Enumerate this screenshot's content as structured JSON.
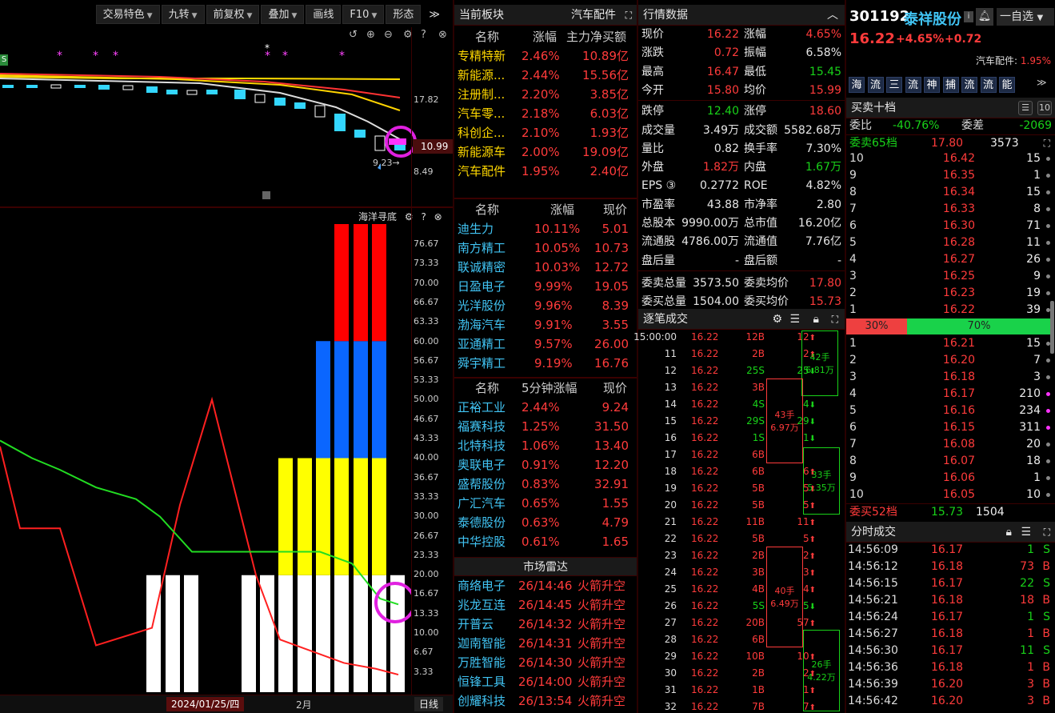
{
  "toolbar": {
    "buttons": [
      "交易特色",
      "九转",
      "前复权",
      "叠加",
      "画线",
      "F10",
      "形态"
    ],
    "more": "≫"
  },
  "kline": {
    "labels": [
      "17.82",
      "10.99",
      "8.49"
    ],
    "low_marker": "9.23",
    "sell_marker": "S"
  },
  "indicator": {
    "title": "海洋寻底",
    "axis": [
      "76.67",
      "73.33",
      "70.00",
      "66.67",
      "63.33",
      "60.00",
      "56.67",
      "53.33",
      "50.00",
      "46.67",
      "43.33",
      "40.00",
      "36.67",
      "33.33",
      "30.00",
      "26.67",
      "23.33",
      "20.00",
      "16.67",
      "13.33",
      "10.00",
      "6.67",
      "3.33"
    ],
    "red_line": [
      42,
      28,
      28,
      8,
      11,
      32,
      50,
      20,
      9,
      5,
      4,
      3,
      20,
      24
    ],
    "green_line": [
      22,
      20,
      18,
      15,
      13,
      10,
      8,
      8,
      7,
      7,
      7,
      6,
      4,
      3
    ],
    "bars": [
      1,
      1,
      1,
      0,
      1,
      1,
      1,
      2,
      2,
      2,
      4,
      4,
      4
    ],
    "date": "2024/01/25/四",
    "month": "2月",
    "period": "日线"
  },
  "sector": {
    "title": "当前板块",
    "current": "汽车配件",
    "headers": [
      "名称",
      "涨幅",
      "主力净买额"
    ],
    "rows": [
      [
        "专精特新",
        "2.46%",
        "10.89亿"
      ],
      [
        "新能源...",
        "2.44%",
        "15.56亿"
      ],
      [
        "注册制...",
        "2.20%",
        "3.85亿"
      ],
      [
        "汽车零...",
        "2.18%",
        "6.03亿"
      ],
      [
        "科创企...",
        "2.10%",
        "1.93亿"
      ],
      [
        "新能源车",
        "2.00%",
        "19.09亿"
      ],
      [
        "汽车配件",
        "1.95%",
        "2.40亿"
      ]
    ]
  },
  "gainers": {
    "headers": [
      "名称",
      "涨幅",
      "现价"
    ],
    "rows": [
      [
        "迪生力",
        "10.11%",
        "5.01"
      ],
      [
        "南方精工",
        "10.05%",
        "10.73"
      ],
      [
        "联诚精密",
        "10.03%",
        "12.72"
      ],
      [
        "日盈电子",
        "9.99%",
        "19.05"
      ],
      [
        "光洋股份",
        "9.96%",
        "8.39"
      ],
      [
        "渤海汽车",
        "9.91%",
        "3.55"
      ],
      [
        "亚通精工",
        "9.57%",
        "26.00"
      ],
      [
        "舜宇精工",
        "9.19%",
        "16.76"
      ]
    ]
  },
  "five_min": {
    "headers": [
      "名称",
      "5分钟涨幅",
      "现价"
    ],
    "rows": [
      [
        "正裕工业",
        "2.44%",
        "9.24"
      ],
      [
        "福赛科技",
        "1.25%",
        "31.50"
      ],
      [
        "北特科技",
        "1.06%",
        "13.40"
      ],
      [
        "奥联电子",
        "0.91%",
        "12.20"
      ],
      [
        "盛帮股份",
        "0.83%",
        "32.91"
      ],
      [
        "广汇汽车",
        "0.65%",
        "1.55"
      ],
      [
        "泰德股份",
        "0.63%",
        "4.79"
      ],
      [
        "中华控股",
        "0.61%",
        "1.65"
      ]
    ]
  },
  "radar": {
    "title": "市场雷达",
    "rows": [
      [
        "商络电子",
        "26/14:46",
        "火箭升空"
      ],
      [
        "兆龙互连",
        "26/14:45",
        "火箭升空"
      ],
      [
        "开普云",
        "26/14:32",
        "火箭升空"
      ],
      [
        "迦南智能",
        "26/14:31",
        "火箭升空"
      ],
      [
        "万胜智能",
        "26/14:30",
        "火箭升空"
      ],
      [
        "恒锋工具",
        "26/14:00",
        "火箭升空"
      ],
      [
        "创耀科技",
        "26/13:54",
        "火箭升空"
      ]
    ]
  },
  "quote": {
    "title": "行情数据",
    "rows": [
      [
        "现价",
        "16.22",
        "涨幅",
        "4.65%"
      ],
      [
        "涨跌",
        "0.72",
        "振幅",
        "6.58%"
      ],
      [
        "最高",
        "16.47",
        "最低",
        "15.45"
      ],
      [
        "今开",
        "15.80",
        "均价",
        "15.99"
      ],
      [
        "跌停",
        "12.40",
        "涨停",
        "18.60"
      ],
      [
        "成交量",
        "3.49万",
        "成交额",
        "5582.68万"
      ],
      [
        "量比",
        "0.82",
        "换手率",
        "7.30%"
      ],
      [
        "外盘",
        "1.82万",
        "内盘",
        "1.67万"
      ],
      [
        "EPS ③",
        "0.2772",
        "ROE",
        "4.82%"
      ],
      [
        "市盈率",
        "43.88",
        "市净率",
        "2.80"
      ],
      [
        "总股本",
        "9990.00万",
        "总市值",
        "16.20亿"
      ],
      [
        "流通股",
        "4786.00万",
        "流通值",
        "7.76亿"
      ],
      [
        "盘后量",
        "-",
        "盘后额",
        "-"
      ],
      [
        "委卖总量",
        "3573.50",
        "委卖均价",
        "17.80"
      ],
      [
        "委买总量",
        "1504.00",
        "委买均价",
        "15.73"
      ]
    ]
  },
  "ticks": {
    "title": "逐笔成交",
    "rows": [
      [
        "15:00:00",
        "16.22",
        "12B",
        "12"
      ],
      [
        "11",
        "16.22",
        "2B",
        "2"
      ],
      [
        "12",
        "16.22",
        "25S",
        "25"
      ],
      [
        "13",
        "16.22",
        "3B",
        ""
      ],
      [
        "14",
        "16.22",
        "4S",
        "4"
      ],
      [
        "15",
        "16.22",
        "29S",
        "29"
      ],
      [
        "16",
        "16.22",
        "1S",
        "1"
      ],
      [
        "17",
        "16.22",
        "6B",
        ""
      ],
      [
        "18",
        "16.22",
        "6B",
        "6"
      ],
      [
        "19",
        "16.22",
        "5B",
        "5"
      ],
      [
        "20",
        "16.22",
        "5B",
        "5"
      ],
      [
        "21",
        "16.22",
        "11B",
        "11"
      ],
      [
        "22",
        "16.22",
        "5B",
        "5"
      ],
      [
        "23",
        "16.22",
        "2B",
        "2"
      ],
      [
        "24",
        "16.22",
        "3B",
        "3"
      ],
      [
        "25",
        "16.22",
        "4B",
        "4"
      ],
      [
        "26",
        "16.22",
        "5S",
        "5"
      ],
      [
        "27",
        "16.22",
        "20B",
        "57"
      ],
      [
        "28",
        "16.22",
        "6B",
        ""
      ],
      [
        "29",
        "16.22",
        "10B",
        "10"
      ],
      [
        "30",
        "16.22",
        "2B",
        "2"
      ],
      [
        "31",
        "16.22",
        "1B",
        "1"
      ],
      [
        "32",
        "16.22",
        "7B",
        "7"
      ]
    ],
    "groups": [
      [
        "42手",
        "6.81万"
      ],
      [
        "43手",
        "6.97万"
      ],
      [
        "33手",
        "5.35万"
      ],
      [
        "40手",
        "6.49万"
      ],
      [
        "26手",
        "4.22万"
      ]
    ]
  },
  "stock": {
    "code": "301192",
    "name": "泰祥股份",
    "price": "16.22",
    "change_pct": "+4.65%",
    "change": "+0.72",
    "sector": "汽车配件:",
    "sector_pct": "1.95%",
    "watch": "一自选",
    "tags": [
      "海",
      "流",
      "三",
      "流",
      "神",
      "捕",
      "流",
      "流",
      "能"
    ]
  },
  "orderbook": {
    "title": "买卖十档",
    "ratio_label": "委比",
    "ratio": "-40.76%",
    "diff_label": "委差",
    "diff": "-2069",
    "sell_label": "委卖65档",
    "sell_avg": "17.80",
    "sell_total": "3573",
    "sell": [
      [
        "10",
        "16.42",
        "15"
      ],
      [
        "9",
        "16.35",
        "1"
      ],
      [
        "8",
        "16.34",
        "15"
      ],
      [
        "7",
        "16.33",
        "8"
      ],
      [
        "6",
        "16.30",
        "71"
      ],
      [
        "5",
        "16.28",
        "11"
      ],
      [
        "4",
        "16.27",
        "26"
      ],
      [
        "3",
        "16.25",
        "9"
      ],
      [
        "2",
        "16.23",
        "19"
      ],
      [
        "1",
        "16.22",
        "39"
      ]
    ],
    "buy_pct": "30%",
    "sell_pct": "70%",
    "buy": [
      [
        "1",
        "16.21",
        "15"
      ],
      [
        "2",
        "16.20",
        "7"
      ],
      [
        "3",
        "16.18",
        "3"
      ],
      [
        "4",
        "16.17",
        "210"
      ],
      [
        "5",
        "16.16",
        "234"
      ],
      [
        "6",
        "16.15",
        "311"
      ],
      [
        "7",
        "16.08",
        "20"
      ],
      [
        "8",
        "16.07",
        "18"
      ],
      [
        "9",
        "16.06",
        "1"
      ],
      [
        "10",
        "16.05",
        "10"
      ]
    ],
    "buy_label": "委买52档",
    "buy_avg": "15.73",
    "buy_total": "1504"
  },
  "minute": {
    "title": "分时成交",
    "rows": [
      [
        "14:56:09",
        "16.17",
        "1",
        "S"
      ],
      [
        "14:56:12",
        "16.18",
        "73",
        "B"
      ],
      [
        "14:56:15",
        "16.17",
        "22",
        "S"
      ],
      [
        "14:56:21",
        "16.18",
        "18",
        "B"
      ],
      [
        "14:56:24",
        "16.17",
        "1",
        "S"
      ],
      [
        "14:56:27",
        "16.18",
        "1",
        "B"
      ],
      [
        "14:56:30",
        "16.17",
        "11",
        "S"
      ],
      [
        "14:56:36",
        "16.18",
        "1",
        "B"
      ],
      [
        "14:56:39",
        "16.20",
        "3",
        "B"
      ],
      [
        "14:56:42",
        "16.20",
        "3",
        "B"
      ]
    ]
  }
}
